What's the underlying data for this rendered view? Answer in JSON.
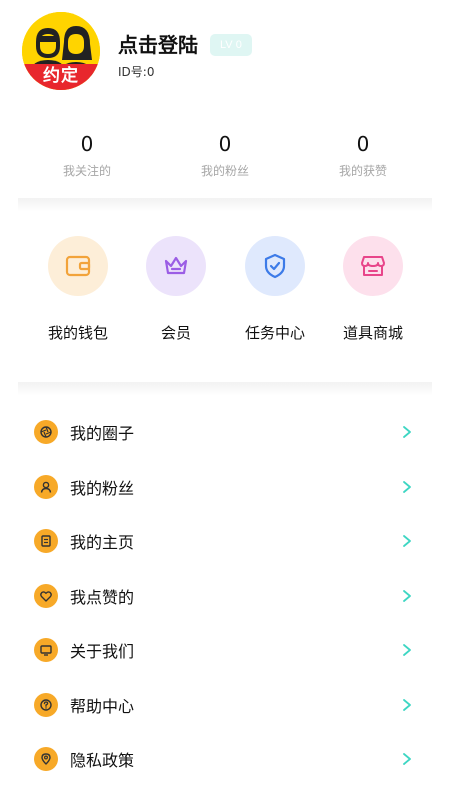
{
  "profile": {
    "avatar_badge": "约定",
    "login_title": "点击登陆",
    "level": "LV 0",
    "user_id": "ID号:0"
  },
  "stats": [
    {
      "value": "0",
      "label": "我关注的"
    },
    {
      "value": "0",
      "label": "我的粉丝"
    },
    {
      "value": "0",
      "label": "我的获赞"
    }
  ],
  "features": [
    {
      "label": "我的钱包",
      "icon": "wallet-icon",
      "bg": "#fdeed8",
      "color": "#f2a33a"
    },
    {
      "label": "会员",
      "icon": "crown-icon",
      "bg": "#ece3fb",
      "color": "#9b5de5"
    },
    {
      "label": "任务中心",
      "icon": "shield-check-icon",
      "bg": "#dfe9fd",
      "color": "#3d7be8"
    },
    {
      "label": "道具商城",
      "icon": "shop-icon",
      "bg": "#fde0ec",
      "color": "#e8458a"
    }
  ],
  "menu": [
    {
      "label": "我的圈子",
      "icon": "circle-aperture-icon"
    },
    {
      "label": "我的粉丝",
      "icon": "user-icon"
    },
    {
      "label": "我的主页",
      "icon": "document-icon"
    },
    {
      "label": "我点赞的",
      "icon": "heart-icon"
    },
    {
      "label": "关于我们",
      "icon": "monitor-icon"
    },
    {
      "label": "帮助中心",
      "icon": "question-icon"
    },
    {
      "label": "隐私政策",
      "icon": "location-privacy-icon"
    }
  ],
  "colors": {
    "menu_icon_bg": "#f7a928",
    "chevron": "#3dd6c3",
    "level_badge_bg": "#dff6f3"
  }
}
